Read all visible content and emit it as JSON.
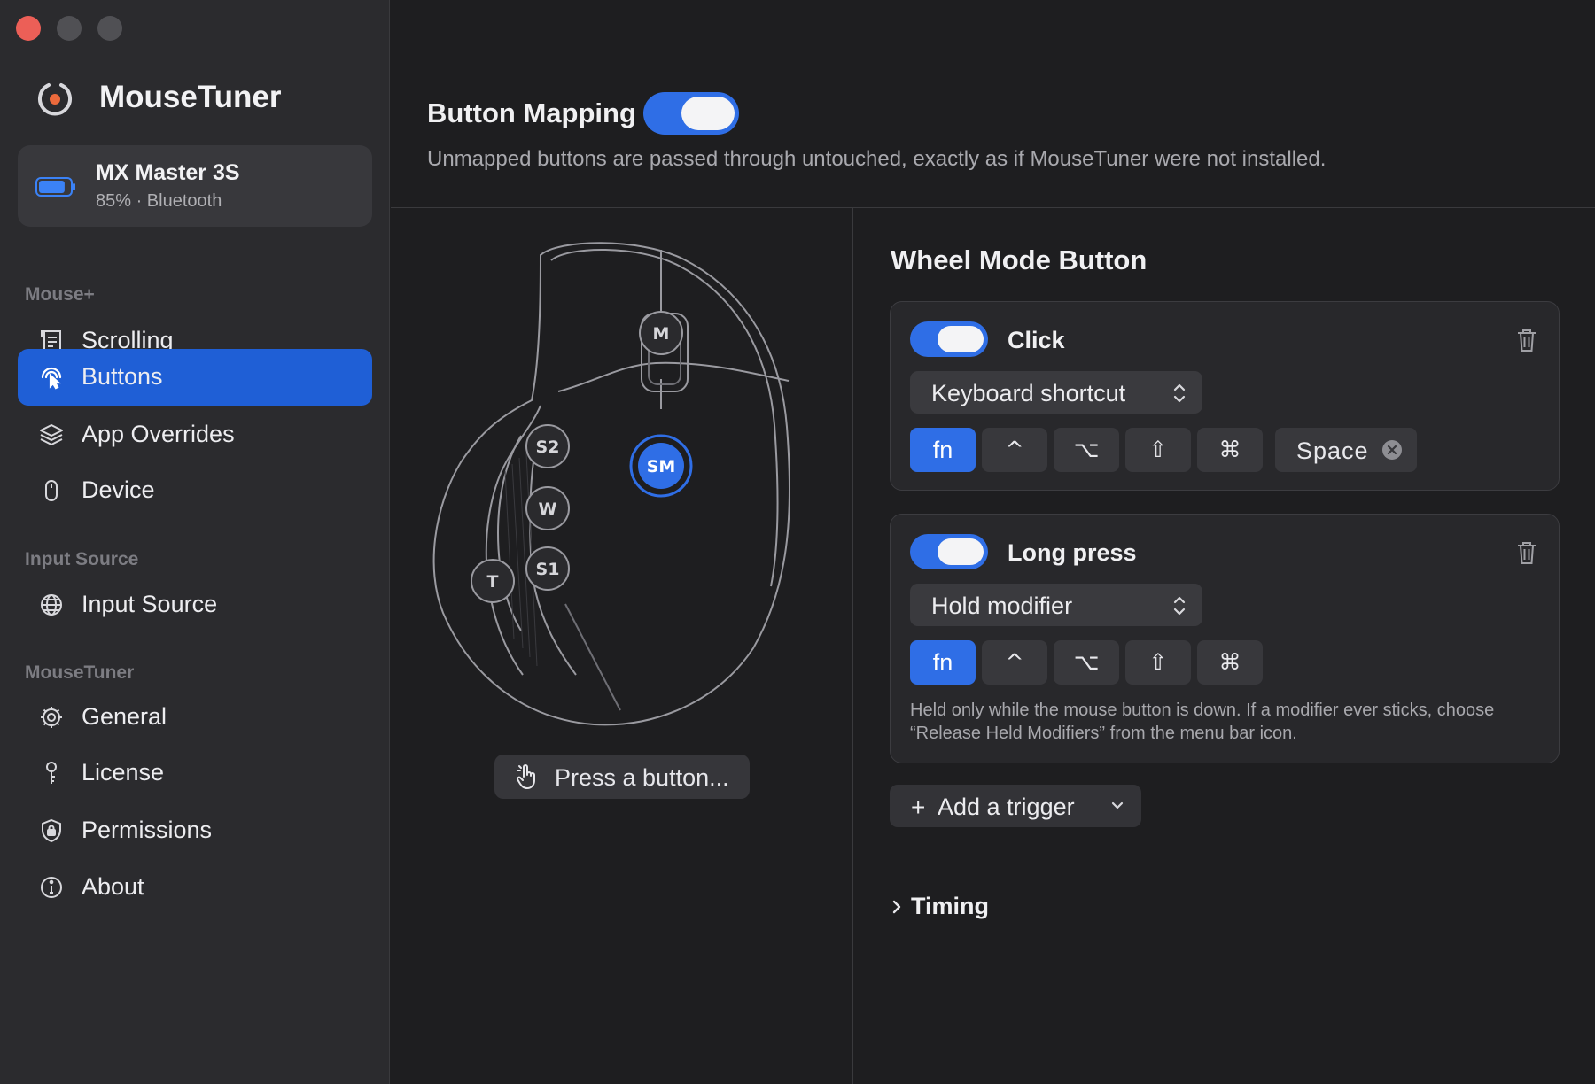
{
  "app": {
    "name": "MouseTuner"
  },
  "device": {
    "name": "MX Master 3S",
    "battery_percent": 85,
    "status": "85% · Bluetooth"
  },
  "sidebar": {
    "sections": [
      {
        "header": "Mouse+",
        "items": [
          {
            "label": "Scrolling",
            "icon": "scroll-icon",
            "active": false
          },
          {
            "label": "Buttons",
            "icon": "pointer-click-icon",
            "active": true
          },
          {
            "label": "App Overrides",
            "icon": "layers-icon",
            "active": false
          },
          {
            "label": "Device",
            "icon": "mouse-icon",
            "active": false
          }
        ]
      },
      {
        "header": "Input Source",
        "items": [
          {
            "label": "Input Source",
            "icon": "globe-icon",
            "active": false
          }
        ]
      },
      {
        "header": "MouseTuner",
        "items": [
          {
            "label": "General",
            "icon": "gear-icon",
            "active": false
          },
          {
            "label": "License",
            "icon": "key-icon",
            "active": false
          },
          {
            "label": "Permissions",
            "icon": "shield-lock-icon",
            "active": false
          },
          {
            "label": "About",
            "icon": "info-icon",
            "active": false
          }
        ]
      }
    ]
  },
  "main": {
    "title": "Button Mapping",
    "enabled": true,
    "subtitle": "Unmapped buttons are passed through untouched, exactly as if MouseTuner were not installed."
  },
  "mouse": {
    "buttons": [
      "M",
      "SM",
      "S2",
      "W",
      "S1",
      "T"
    ],
    "selected": "SM",
    "press_button_label": "Press a button..."
  },
  "wheel_mode": {
    "title": "Wheel Mode Button",
    "triggers": [
      {
        "title": "Click",
        "enabled": true,
        "action": "Keyboard shortcut",
        "modifiers": [
          {
            "label": "fn",
            "on": true
          },
          {
            "label": "^",
            "on": false
          },
          {
            "label": "⌥",
            "on": false
          },
          {
            "label": "⇧",
            "on": false
          },
          {
            "label": "⌘",
            "on": false
          }
        ],
        "key": "Space"
      },
      {
        "title": "Long press",
        "enabled": true,
        "action": "Hold modifier",
        "modifiers": [
          {
            "label": "fn",
            "on": true
          },
          {
            "label": "^",
            "on": false
          },
          {
            "label": "⌥",
            "on": false
          },
          {
            "label": "⇧",
            "on": false
          },
          {
            "label": "⌘",
            "on": false
          }
        ],
        "note": "Held only while the mouse button is down. If a modifier ever sticks, choose “Release Held Modifiers” from the menu bar icon."
      }
    ],
    "add_trigger_label": "Add a trigger",
    "timing_label": "Timing"
  },
  "colors": {
    "accent": "#2f6ee6",
    "sidebar_active": "#1f5fd6",
    "close": "#ec5f57"
  }
}
